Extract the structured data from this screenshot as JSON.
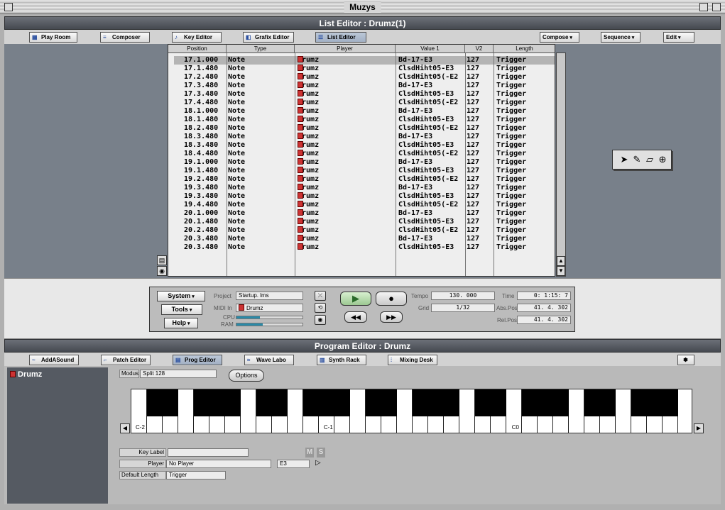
{
  "app": {
    "title": "Muzys"
  },
  "list_editor": {
    "title": "List Editor : Drumz(1)",
    "views": [
      "Play Room",
      "Composer",
      "Key Editor",
      "Grafix Editor",
      "List Editor"
    ],
    "menus": [
      "Compose",
      "Sequence",
      "Edit"
    ],
    "columns": [
      "Position",
      "Type",
      "Player",
      "Value 1",
      "V2",
      "Length"
    ],
    "rows": [
      [
        "17.1.000",
        "Note",
        "Drumz",
        "Bd-17-E3",
        "127",
        "Trigger"
      ],
      [
        "17.1.480",
        "Note",
        "Drumz",
        "ClsdHiht05-E3",
        "127",
        "Trigger"
      ],
      [
        "17.2.480",
        "Note",
        "Drumz",
        "ClsdHiht05(-E2",
        "127",
        "Trigger"
      ],
      [
        "17.3.480",
        "Note",
        "Drumz",
        "Bd-17-E3",
        "127",
        "Trigger"
      ],
      [
        "17.3.480",
        "Note",
        "Drumz",
        "ClsdHiht05-E3",
        "127",
        "Trigger"
      ],
      [
        "17.4.480",
        "Note",
        "Drumz",
        "ClsdHiht05(-E2",
        "127",
        "Trigger"
      ],
      [
        "18.1.000",
        "Note",
        "Drumz",
        "Bd-17-E3",
        "127",
        "Trigger"
      ],
      [
        "18.1.480",
        "Note",
        "Drumz",
        "ClsdHiht05-E3",
        "127",
        "Trigger"
      ],
      [
        "18.2.480",
        "Note",
        "Drumz",
        "ClsdHiht05(-E2",
        "127",
        "Trigger"
      ],
      [
        "18.3.480",
        "Note",
        "Drumz",
        "Bd-17-E3",
        "127",
        "Trigger"
      ],
      [
        "18.3.480",
        "Note",
        "Drumz",
        "ClsdHiht05-E3",
        "127",
        "Trigger"
      ],
      [
        "18.4.480",
        "Note",
        "Drumz",
        "ClsdHiht05(-E2",
        "127",
        "Trigger"
      ],
      [
        "19.1.000",
        "Note",
        "Drumz",
        "Bd-17-E3",
        "127",
        "Trigger"
      ],
      [
        "19.1.480",
        "Note",
        "Drumz",
        "ClsdHiht05-E3",
        "127",
        "Trigger"
      ],
      [
        "19.2.480",
        "Note",
        "Drumz",
        "ClsdHiht05(-E2",
        "127",
        "Trigger"
      ],
      [
        "19.3.480",
        "Note",
        "Drumz",
        "Bd-17-E3",
        "127",
        "Trigger"
      ],
      [
        "19.3.480",
        "Note",
        "Drumz",
        "ClsdHiht05-E3",
        "127",
        "Trigger"
      ],
      [
        "19.4.480",
        "Note",
        "Drumz",
        "ClsdHiht05(-E2",
        "127",
        "Trigger"
      ],
      [
        "20.1.000",
        "Note",
        "Drumz",
        "Bd-17-E3",
        "127",
        "Trigger"
      ],
      [
        "20.1.480",
        "Note",
        "Drumz",
        "ClsdHiht05-E3",
        "127",
        "Trigger"
      ],
      [
        "20.2.480",
        "Note",
        "Drumz",
        "ClsdHiht05(-E2",
        "127",
        "Trigger"
      ],
      [
        "20.3.480",
        "Note",
        "Drumz",
        "Bd-17-E3",
        "127",
        "Trigger"
      ],
      [
        "20.3.480",
        "Note",
        "Drumz",
        "ClsdHiht05-E3",
        "127",
        "Trigger"
      ]
    ],
    "selected_row": 0,
    "tools": [
      "arrow-pointer-icon",
      "pencil-icon",
      "eraser-icon",
      "zoom-icon"
    ]
  },
  "transport": {
    "menus": [
      "System",
      "Tools",
      "Help"
    ],
    "project_label": "Project",
    "project_value": "Startup. lms",
    "midi_in_label": "MIDI In",
    "midi_in_value": "Drumz",
    "cpu_label": "CPU",
    "ram_label": "RAM",
    "cpu_level": 0.35,
    "ram_level": 0.4,
    "tempo_label": "Tempo",
    "tempo_value": "130. 000",
    "grid_label": "Grid",
    "grid_value": "1/32",
    "time_label": "Time",
    "time_value": "0: 1:15: 7",
    "abs_label": "Abs.Pos",
    "abs_value": "41. 4. 302",
    "rel_label": "Rel.Pos",
    "rel_value": "41. 4. 302"
  },
  "program_editor": {
    "title": "Program Editor : Drumz",
    "views": [
      "AddASound",
      "Patch Editor",
      "Prog Editor",
      "Wave Labo",
      "Synth Rack",
      "Mixing Desk"
    ],
    "sidebar_item": "Drumz",
    "modus_label": "Modus",
    "modus_value": "Split 128",
    "options_label": "Options",
    "octave_labels": [
      "C-2",
      "C-1",
      "C0"
    ],
    "key_label_label": "Key Label",
    "key_label_value": "",
    "m_label": "M",
    "s_label": "S",
    "player_label": "Player",
    "player_value": "No Player",
    "player_note": "E3",
    "default_length_label": "Default Length",
    "default_length_value": "Trigger"
  },
  "colors": {
    "accent": "#2a8aa8",
    "header": "#4f535a"
  }
}
